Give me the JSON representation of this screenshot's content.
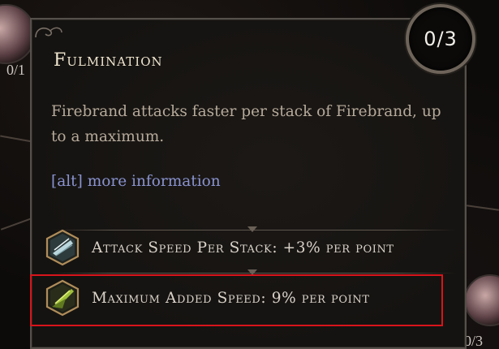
{
  "skill": {
    "name": "Fulmination",
    "points": "0/3",
    "description": "Firebrand attacks faster per stack of Firebrand, up to a maximum.",
    "alt_info": "[alt] more information"
  },
  "stats": [
    {
      "label": "Attack Speed Per Stack: +3% per point",
      "icon": "blade-speed-icon"
    },
    {
      "label": "Maximum Added Speed: 9% per point",
      "icon": "green-blade-icon"
    }
  ],
  "background": {
    "left_node_count": "0/1",
    "right_node_count": "0/3"
  },
  "colors": {
    "highlight": "#d8141b",
    "alt_link": "#8a93cf",
    "title": "#efe5cf"
  }
}
